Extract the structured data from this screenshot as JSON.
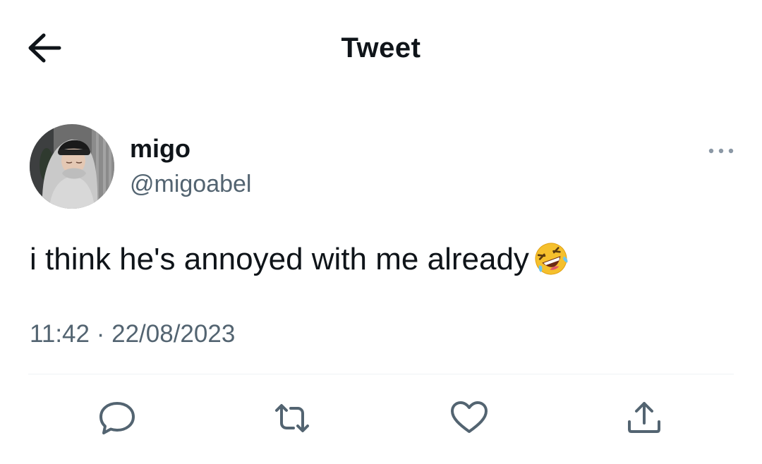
{
  "header": {
    "title": "Tweet",
    "back_icon": "arrow-left-icon"
  },
  "tweet": {
    "author": {
      "display_name": "migo",
      "handle": "@migoabel"
    },
    "text": "i think he's annoyed with me already",
    "emoji": "rolling-on-the-floor-laughing",
    "time": "11:42",
    "separator": "·",
    "date": "22/08/2023"
  },
  "actions": [
    {
      "icon": "reply-icon"
    },
    {
      "icon": "retweet-icon"
    },
    {
      "icon": "like-icon"
    },
    {
      "icon": "share-icon"
    }
  ],
  "colors": {
    "text_primary": "#0f1419",
    "text_secondary": "#536471",
    "divider": "#eff3f4",
    "background": "#ffffff"
  }
}
